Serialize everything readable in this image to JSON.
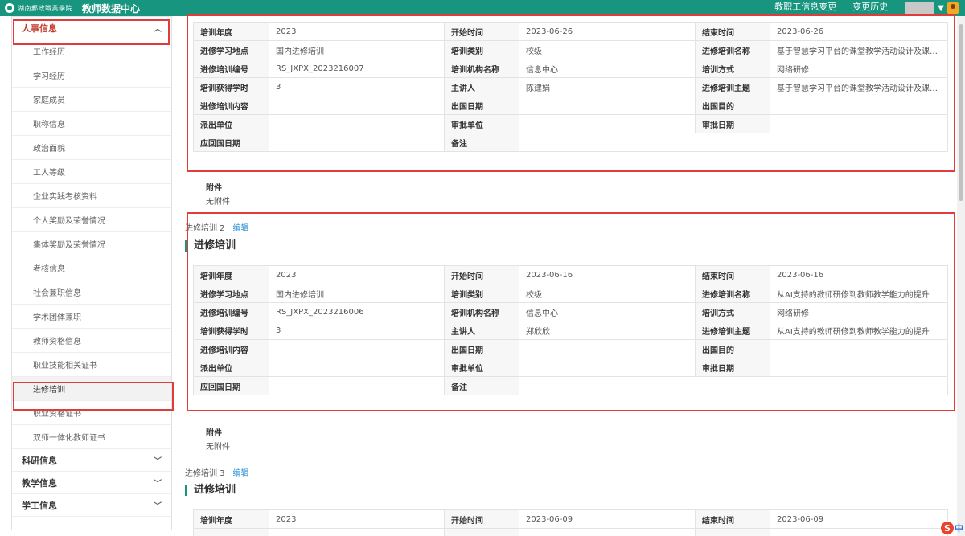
{
  "header": {
    "school_logo_text": "湖南郵政職業學院",
    "title": "教师数据中心",
    "tabs": [
      "教职工信息变更",
      "变更历史"
    ]
  },
  "sidebar": {
    "groups": [
      {
        "label": "人事信息",
        "expanded": true,
        "chevron": "chevron-up-icon"
      },
      {
        "label": "科研信息",
        "expanded": false,
        "chevron": "chevron-down-icon"
      },
      {
        "label": "教学信息",
        "expanded": false,
        "chevron": "chevron-down-icon"
      },
      {
        "label": "学工信息",
        "expanded": false,
        "chevron": "chevron-down-icon"
      }
    ],
    "items": [
      "工作经历",
      "学习经历",
      "家庭成员",
      "职称信息",
      "政治面貌",
      "工人等级",
      "企业实践考核资料",
      "个人奖励及荣誉情况",
      "集体奖励及荣誉情况",
      "考核信息",
      "社会兼职信息",
      "学术团体兼职",
      "教师资格信息",
      "职业技能相关证书",
      "进修培训",
      "职业资格证书",
      "双师一体化教师证书"
    ],
    "active_item": "进修培训"
  },
  "labels": {
    "year": "培训年度",
    "start": "开始时间",
    "end": "结束时间",
    "place": "进修学习地点",
    "category": "培训类别",
    "name": "进修培训名称",
    "code": "进修培训编号",
    "org": "培训机构名称",
    "method": "培训方式",
    "hours": "培训获得学时",
    "lecturer": "主讲人",
    "topic": "进修培训主题",
    "content": "进修培训内容",
    "exit_date": "出国日期",
    "exit_purpose": "出国目的",
    "dispatch_unit": "派出单位",
    "approve_unit": "审批单位",
    "approve_date": "审批日期",
    "return_date": "应回国日期",
    "remark": "备注",
    "attachment": "附件",
    "no_attachment": "无附件",
    "edit": "编辑",
    "section_title": "进修培训"
  },
  "records": [
    {
      "year": "2023",
      "start": "2023-06-26",
      "end": "2023-06-26",
      "place": "国内进修培训",
      "category": "校级",
      "name": "基于智慧学习平台的课堂教学活动设计及课堂研究...",
      "code": "RS_JXPX_2023216007",
      "org": "信息中心",
      "method": "网络研修",
      "hours": "3",
      "lecturer": "陈建娟",
      "topic": "基于智慧学习平台的课堂教学活动设计及课堂研究..."
    },
    {
      "sub_label": "进修培训 2",
      "year": "2023",
      "start": "2023-06-16",
      "end": "2023-06-16",
      "place": "国内进修培训",
      "category": "校级",
      "name": "从AI支持的教师研修到教师教学能力的提升",
      "code": "RS_JXPX_2023216006",
      "org": "信息中心",
      "method": "网络研修",
      "hours": "3",
      "lecturer": "郑欣欣",
      "topic": "从AI支持的教师研修到教师教学能力的提升"
    },
    {
      "sub_label": "进修培训 3",
      "year": "2023",
      "start": "2023-06-09",
      "end": "2023-06-09"
    }
  ],
  "ime": {
    "logo": "S",
    "mode": "中"
  },
  "colors": {
    "brand": "#17957f",
    "highlight_box": "#e03c3c",
    "link": "#2a8fd6"
  }
}
